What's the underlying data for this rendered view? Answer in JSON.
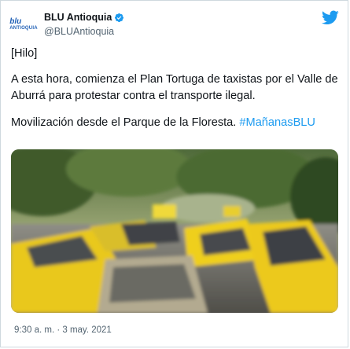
{
  "account": {
    "display_name": "BLU Antioquia",
    "handle": "@BLUAntioquia",
    "logo_line1": "blu",
    "logo_line2": "ANTIOQUIA"
  },
  "tweet": {
    "p1": "[Hilo]",
    "p2": "A esta hora, comienza el Plan Tortuga de taxistas por el Valle de Aburrá para protestar contra el transporte ilegal.",
    "p3_text": "Movilización desde el Parque de la Floresta. ",
    "hashtag": "#MañanasBLU",
    "timestamp": "9:30 a. m. · 3 may. 2021"
  },
  "icons": {
    "verified": "verified-badge-icon",
    "bird": "twitter-bird-icon"
  },
  "colors": {
    "accent": "#1d9bf0",
    "secondary_text": "#536471",
    "taxi_yellow": "#f2d21b"
  }
}
